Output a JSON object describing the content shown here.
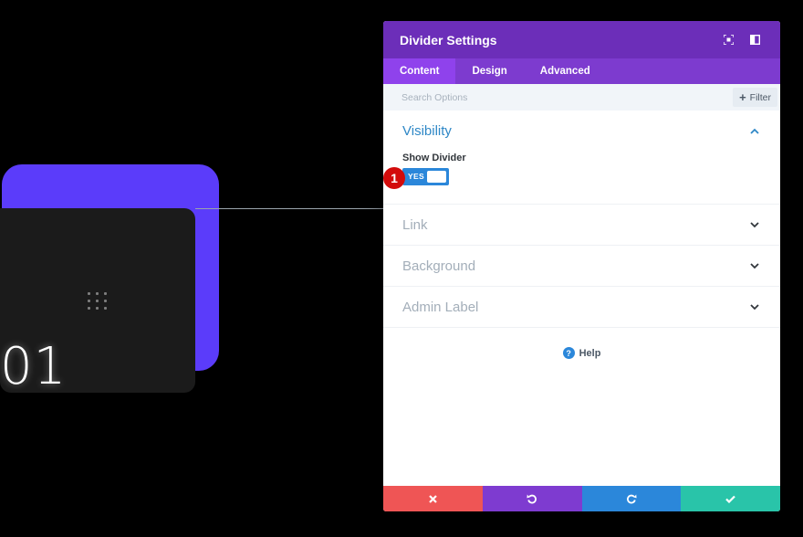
{
  "preview": {
    "number": "01"
  },
  "panel": {
    "title": "Divider Settings",
    "tabs": [
      {
        "label": "Content"
      },
      {
        "label": "Design"
      },
      {
        "label": "Advanced"
      }
    ],
    "search": {
      "placeholder": "Search Options",
      "filter_label": "Filter"
    },
    "sections": [
      {
        "title": "Visibility",
        "open": true
      },
      {
        "title": "Link",
        "open": false
      },
      {
        "title": "Background",
        "open": false
      },
      {
        "title": "Admin Label",
        "open": false
      }
    ],
    "visibility": {
      "show_divider_label": "Show Divider",
      "toggle_value": "YES"
    },
    "step_badge": "1",
    "help_label": "Help",
    "footer_colors": {
      "cancel": "#ef5555",
      "undo": "#7e3bd0",
      "redo": "#2b87da",
      "save": "#29c4a9"
    }
  },
  "colors": {
    "header": "#6c2eb9",
    "tabs": "#7d3bcf",
    "active_tab": "#8f42ec",
    "accent": "#2e87c6",
    "preview_card": "#5b3cfa"
  }
}
